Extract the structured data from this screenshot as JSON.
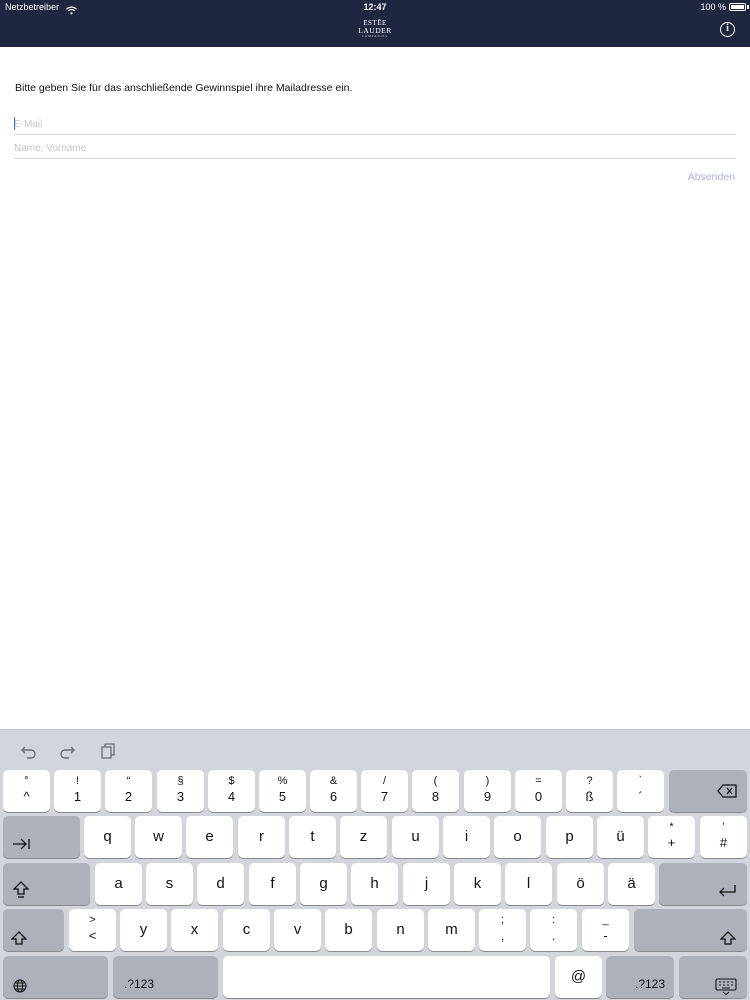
{
  "status_bar": {
    "carrier": "Netzbetreiber",
    "time": "12:47",
    "battery": "100 %",
    "battery_level": 1.0
  },
  "header": {
    "logo_line1": "ESTĒE",
    "logo_line2": "LAUDER",
    "logo_line3": "COMPANIES",
    "info_icon": "info-icon",
    "background_color": "#1f2740"
  },
  "form": {
    "instruction": "Bitte geben Sie für das anschließende Gewinnspiel ihre Mailadresse ein.",
    "email_placeholder": "E-Mail",
    "name_placeholder": "Name, Vorname",
    "submit_label": "Absenden",
    "submit_color": "#a9b4ec"
  },
  "keyboard": {
    "toolbar_icons": [
      "undo-icon",
      "redo-icon",
      "paste-icon"
    ],
    "row1": [
      {
        "top": "°",
        "bottom": "^"
      },
      {
        "top": "!",
        "bottom": "1"
      },
      {
        "top": "“",
        "bottom": "2"
      },
      {
        "top": "§",
        "bottom": "3"
      },
      {
        "top": "$",
        "bottom": "4"
      },
      {
        "top": "%",
        "bottom": "5"
      },
      {
        "top": "&",
        "bottom": "6"
      },
      {
        "top": "/",
        "bottom": "7"
      },
      {
        "top": "(",
        "bottom": "8"
      },
      {
        "top": ")",
        "bottom": "9"
      },
      {
        "top": "=",
        "bottom": "0"
      },
      {
        "top": "?",
        "bottom": "ß"
      },
      {
        "top": "`",
        "bottom": "´"
      }
    ],
    "row2": [
      "q",
      "w",
      "e",
      "r",
      "t",
      "z",
      "u",
      "i",
      "o",
      "p",
      "ü"
    ],
    "row2_extra": [
      {
        "top": "*",
        "bottom": "+"
      },
      {
        "top": "’",
        "bottom": "#"
      }
    ],
    "row3": [
      "a",
      "s",
      "d",
      "f",
      "g",
      "h",
      "j",
      "k",
      "l",
      "ö",
      "ä"
    ],
    "row4_angle": {
      "top": ">",
      "bottom": "<"
    },
    "row4": [
      "y",
      "x",
      "c",
      "v",
      "b",
      "n",
      "m"
    ],
    "row4_punct": [
      {
        "top": ";",
        "bottom": ","
      },
      {
        "top": ":",
        "bottom": "."
      },
      {
        "top": "_",
        "bottom": "-"
      }
    ],
    "num_label": ".?123",
    "at_label": "@",
    "special_icons": [
      "backspace-icon",
      "tab-icon",
      "caps-lock-icon",
      "return-icon",
      "shift-icon",
      "globe-icon",
      "hide-keyboard-icon"
    ]
  }
}
